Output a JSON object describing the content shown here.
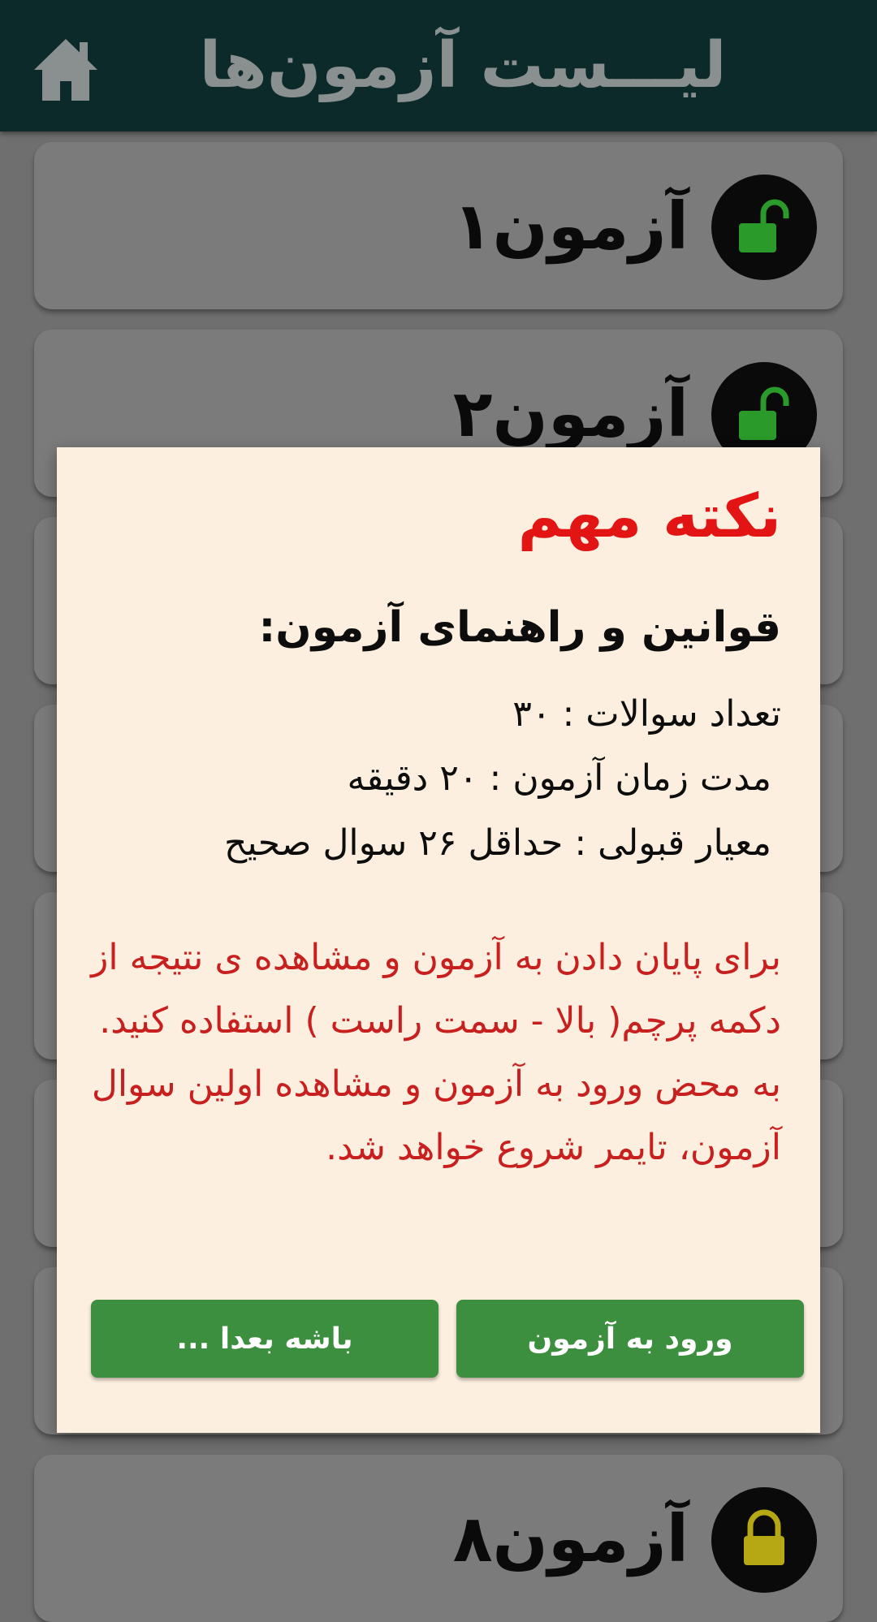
{
  "header": {
    "title": "لیـــست آزمون‌ها",
    "home_icon": "home-icon"
  },
  "exams": [
    {
      "title": "آزمون۱",
      "status": "unlocked",
      "lock_color": "#2a9a2a"
    },
    {
      "title": "آزمون۲",
      "status": "unlocked",
      "lock_color": "#2a9a2a"
    },
    {
      "title": "",
      "status": "hidden"
    },
    {
      "title": "",
      "status": "hidden"
    },
    {
      "title": "",
      "status": "hidden"
    },
    {
      "title": "",
      "status": "hidden"
    },
    {
      "title": "",
      "status": "hidden"
    },
    {
      "title": "آزمون۸",
      "status": "locked",
      "lock_color": "#b6a814"
    }
  ],
  "dialog": {
    "title": "نکته مهم",
    "subtitle": "قوانین و راهنمای آزمون:",
    "rules": [
      "تعداد سوالات : ۳۰",
      "مدت زمان آزمون : ۲۰ دقیقه",
      "معیار قبولی : حداقل ۲۶ سوال صحیح"
    ],
    "notice": "برای پایان دادن به آزمون و مشاهده ی نتیجه از دکمه پرچم( بالا - سمت راست ) استفاده کنید. به محض ورود به آزمون و مشاهده اولین سوال آزمون، تایمر شروع خواهد شد.",
    "enter_button": "ورود به آزمون",
    "later_button": "باشه بعدا ..."
  },
  "colors": {
    "header_bg": "#0d2a2b",
    "dialog_bg": "#fdefdf",
    "accent_red": "#e31414",
    "button_green": "#3b8f3e"
  }
}
